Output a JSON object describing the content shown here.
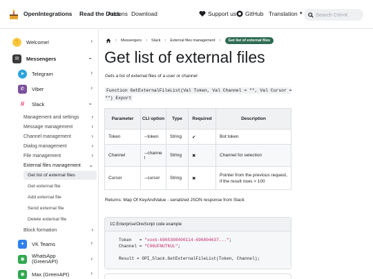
{
  "header": {
    "brand": "OpenIntegrations",
    "nav": {
      "docs": "Read the Docs",
      "addons": "Addons",
      "download": "Download"
    },
    "support": "Support us",
    "github": "GitHub",
    "translation": "Translation",
    "search_placeholder": "Search Ctrl+K"
  },
  "sidebar": {
    "welcome": "Welcome!",
    "messengers": "Messengers",
    "telegram": "Telegram",
    "viber": "Viber",
    "slack": "Slack",
    "slack_sections": {
      "management": "Management and settings",
      "message": "Message management",
      "channel": "Channel management",
      "dialog": "Dialog management",
      "file": "File management",
      "external": "External files management",
      "block": "Block formation"
    },
    "external_methods": {
      "get_list": "Get list of external files",
      "get_file": "Get external file",
      "add_file": "Add external file",
      "send_file": "Send external file",
      "delete_file": "Delete external file"
    },
    "vkteams": "VK Teams",
    "whatsapp": "WhatsApp (GreenAPI)",
    "max": "Max (GreenAPI)"
  },
  "breadcrumbs": {
    "messengers": "Messengers",
    "slack": "Slack",
    "external": "External files management",
    "current": "Get list of external files"
  },
  "page": {
    "title": "Get list of external files",
    "description": "Gets a list of external files of a user or channel",
    "signature": "Function GetExternalFileList(Val Token, Val Channel = \"\", Val Cursor = \"\") Export",
    "returns": "Returns: Map Of KeyAndValue - serialized JSON response from Slack"
  },
  "params_table": {
    "headers": [
      "Parameter",
      "CLI option",
      "Type",
      "Required",
      "Description"
    ],
    "rows": [
      {
        "name": "Token",
        "cli": "--token",
        "type": "String",
        "required": "✔",
        "desc": "Bot token"
      },
      {
        "name": "Channel",
        "cli": "--channel",
        "type": "String",
        "required": "✖",
        "desc": "Channel for selection"
      },
      {
        "name": "Cursor",
        "cli": "--cursor",
        "type": "String",
        "required": "✖",
        "desc": "Pointer from the previous request, if the result rows > 100"
      }
    ]
  },
  "code_example": {
    "title": "1C:Enterprise/OneScript code example",
    "token_label": "Token   = ",
    "token_value": "\"xoxb-6965308400114-696804637...\"",
    "channel_label": "Channel = ",
    "channel_value": "\"C06UFNUTKUL\"",
    "result_line": "Result = OPI_Slack.GetExternalFileList(Token, Channel);"
  },
  "icons": {
    "logo": "cake-icon",
    "welcome": "waving-hand-icon",
    "messengers": "mailbox-icon",
    "telegram": "telegram-icon",
    "viber": "viber-icon",
    "slack": "slack-icon",
    "vkteams": "vkteams-icon",
    "whatsapp": "whatsapp-icon",
    "max": "max-icon"
  },
  "colors": {
    "accent": "#2e6b52",
    "string": "#c0266a"
  }
}
